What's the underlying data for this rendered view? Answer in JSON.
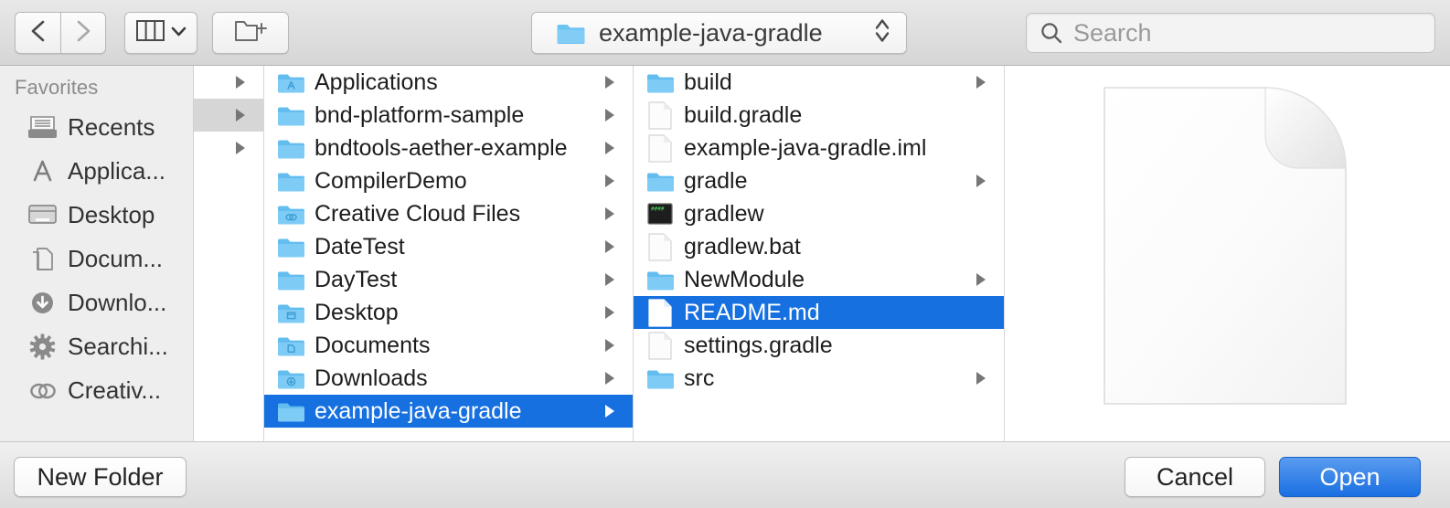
{
  "toolbar": {
    "back_icon": "chevron-left-icon",
    "forward_icon": "chevron-right-icon",
    "view_icon": "column-view-icon",
    "view_chevron_icon": "chevron-down-icon",
    "new_folder_icon": "new-folder-icon",
    "path": {
      "label": "example-java-gradle",
      "icon": "folder-icon",
      "stepper_icon": "up-down-stepper-icon"
    },
    "search": {
      "icon": "search-icon",
      "placeholder": "Search",
      "value": ""
    }
  },
  "sidebar": {
    "header": "Favorites",
    "items": [
      {
        "label": "Recents",
        "icon": "recents-icon"
      },
      {
        "label": "Applica...",
        "icon": "applications-icon"
      },
      {
        "label": "Desktop",
        "icon": "desktop-icon"
      },
      {
        "label": "Docum...",
        "icon": "documents-icon"
      },
      {
        "label": "Downlo...",
        "icon": "downloads-icon"
      },
      {
        "label": "Searchi...",
        "icon": "gear-icon"
      },
      {
        "label": "Creativ...",
        "icon": "creative-cloud-icon"
      }
    ]
  },
  "columns": {
    "col0": {
      "rows": [
        {
          "arrow": true,
          "highlight": false
        },
        {
          "arrow": true,
          "highlight": true
        },
        {
          "arrow": true,
          "highlight": false
        },
        {
          "arrow": false,
          "highlight": false
        },
        {
          "arrow": false,
          "highlight": false
        },
        {
          "arrow": false,
          "highlight": false
        },
        {
          "arrow": false,
          "highlight": false
        },
        {
          "arrow": false,
          "highlight": false
        },
        {
          "arrow": false,
          "highlight": false
        },
        {
          "arrow": false,
          "highlight": false
        },
        {
          "arrow": false,
          "highlight": false
        }
      ]
    },
    "col1": {
      "rows": [
        {
          "label": "Applications",
          "icon": "folder-applications-icon",
          "kind": "folder",
          "arrow": true,
          "selected": false
        },
        {
          "label": "bnd-platform-sample",
          "icon": "folder-icon",
          "kind": "folder",
          "arrow": true,
          "selected": false
        },
        {
          "label": "bndtools-aether-example",
          "icon": "folder-icon",
          "kind": "folder",
          "arrow": true,
          "selected": false
        },
        {
          "label": "CompilerDemo",
          "icon": "folder-icon",
          "kind": "folder",
          "arrow": true,
          "selected": false
        },
        {
          "label": "Creative Cloud Files",
          "icon": "folder-creativecloud-icon",
          "kind": "folder",
          "arrow": true,
          "selected": false
        },
        {
          "label": "DateTest",
          "icon": "folder-icon",
          "kind": "folder",
          "arrow": true,
          "selected": false
        },
        {
          "label": "DayTest",
          "icon": "folder-icon",
          "kind": "folder",
          "arrow": true,
          "selected": false
        },
        {
          "label": "Desktop",
          "icon": "folder-desktop-icon",
          "kind": "folder",
          "arrow": true,
          "selected": false
        },
        {
          "label": "Documents",
          "icon": "folder-documents-icon",
          "kind": "folder",
          "arrow": true,
          "selected": false
        },
        {
          "label": "Downloads",
          "icon": "folder-downloads-icon",
          "kind": "folder",
          "arrow": true,
          "selected": false
        },
        {
          "label": "example-java-gradle",
          "icon": "folder-icon",
          "kind": "folder",
          "arrow": true,
          "selected": true
        }
      ]
    },
    "col2": {
      "rows": [
        {
          "label": "build",
          "icon": "folder-icon",
          "kind": "folder",
          "arrow": true,
          "selected": false
        },
        {
          "label": "build.gradle",
          "icon": "document-icon",
          "kind": "file",
          "arrow": false,
          "selected": false
        },
        {
          "label": "example-java-gradle.iml",
          "icon": "document-icon",
          "kind": "file",
          "arrow": false,
          "selected": false
        },
        {
          "label": "gradle",
          "icon": "folder-icon",
          "kind": "folder",
          "arrow": true,
          "selected": false
        },
        {
          "label": "gradlew",
          "icon": "executable-icon",
          "kind": "file",
          "arrow": false,
          "selected": false
        },
        {
          "label": "gradlew.bat",
          "icon": "document-icon",
          "kind": "file",
          "arrow": false,
          "selected": false
        },
        {
          "label": "NewModule",
          "icon": "folder-icon",
          "kind": "folder",
          "arrow": true,
          "selected": false
        },
        {
          "label": "README.md",
          "icon": "document-icon",
          "kind": "file",
          "arrow": false,
          "selected": true
        },
        {
          "label": "settings.gradle",
          "icon": "document-icon",
          "kind": "file",
          "arrow": false,
          "selected": false
        },
        {
          "label": "src",
          "icon": "folder-icon",
          "kind": "folder",
          "arrow": true,
          "selected": false
        }
      ]
    }
  },
  "preview": {
    "icon": "document-preview-icon"
  },
  "footer": {
    "new_folder_label": "New Folder",
    "cancel_label": "Cancel",
    "open_label": "Open"
  },
  "colors": {
    "selection_blue": "#1670e0",
    "default_button_blue": "#1a6fe2",
    "folder_blue": "#6fc5f5",
    "window_chrome": "#ececec"
  }
}
